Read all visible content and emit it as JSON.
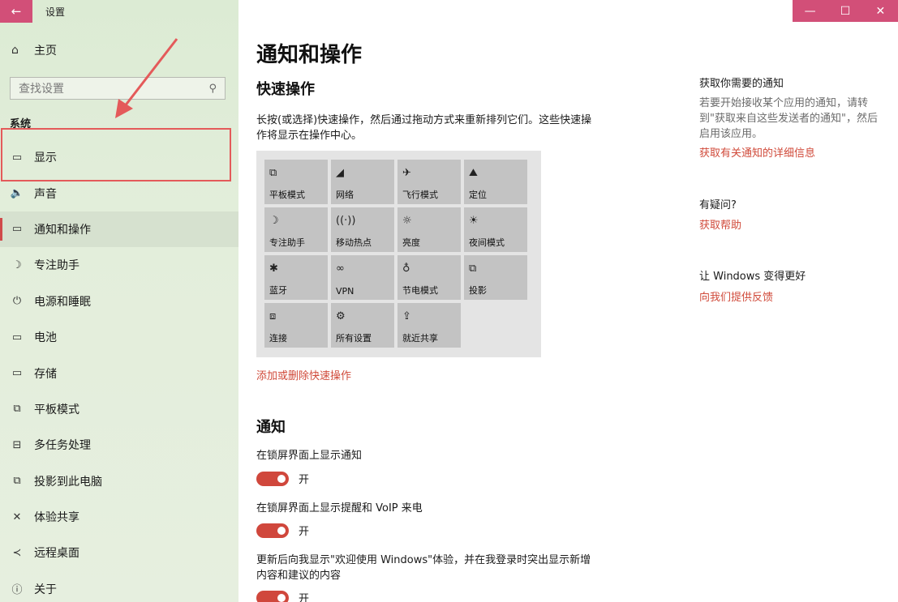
{
  "window": {
    "back_icon": "←",
    "title": "设置",
    "minimize_icon": "—",
    "maximize_icon": "☐",
    "close_icon": "✕"
  },
  "sidebar": {
    "home": {
      "icon": "⌂",
      "label": "主页"
    },
    "search": {
      "placeholder": "查找设置",
      "icon": "⚲"
    },
    "section_title": "系统",
    "items": [
      {
        "icon": "▭",
        "label": "显示"
      },
      {
        "icon": "🔈",
        "label": "声音"
      },
      {
        "icon": "▭",
        "label": "通知和操作"
      },
      {
        "icon": "☽",
        "label": "专注助手"
      },
      {
        "icon": "⏻",
        "label": "电源和睡眠"
      },
      {
        "icon": "▭",
        "label": "电池"
      },
      {
        "icon": "▭",
        "label": "存储"
      },
      {
        "icon": "⧉",
        "label": "平板模式"
      },
      {
        "icon": "⊟",
        "label": "多任务处理"
      },
      {
        "icon": "⧉",
        "label": "投影到此电脑"
      },
      {
        "icon": "✕",
        "label": "体验共享"
      },
      {
        "icon": "≺",
        "label": "远程桌面"
      },
      {
        "icon": "ⓘ",
        "label": "关于"
      }
    ],
    "active_index": 2
  },
  "main": {
    "page_title": "通知和操作",
    "quick_actions": {
      "title": "快速操作",
      "description": "长按(或选择)快速操作，然后通过拖动方式来重新排列它们。这些快速操作将显示在操作中心。",
      "tiles": [
        {
          "icon": "⧉",
          "label": "平板模式"
        },
        {
          "icon": "◢",
          "label": "网络"
        },
        {
          "icon": "✈",
          "label": "飞行模式"
        },
        {
          "icon": "⛰",
          "label": "定位"
        },
        {
          "icon": "☽",
          "label": "专注助手"
        },
        {
          "icon": "((·))",
          "label": "移动热点"
        },
        {
          "icon": "☼",
          "label": "亮度"
        },
        {
          "icon": "☀",
          "label": "夜间模式"
        },
        {
          "icon": "✱",
          "label": "蓝牙"
        },
        {
          "icon": "∞",
          "label": "VPN"
        },
        {
          "icon": "♁",
          "label": "节电模式"
        },
        {
          "icon": "⧉",
          "label": "投影"
        },
        {
          "icon": "⧈",
          "label": "连接"
        },
        {
          "icon": "⚙",
          "label": "所有设置"
        },
        {
          "icon": "⇪",
          "label": "就近共享"
        }
      ],
      "add_remove_link": "添加或删除快速操作"
    },
    "notifications": {
      "title": "通知",
      "settings": [
        {
          "label": "在锁屏界面上显示通知",
          "state": "开"
        },
        {
          "label": "在锁屏界面上显示提醒和 VoIP 来电",
          "state": "开"
        },
        {
          "label": "更新后向我显示\"欢迎使用 Windows\"体验，并在我登录时突出显示新增内容和建议的内容",
          "state": "开"
        }
      ]
    }
  },
  "right_panel": {
    "notify_title": "获取你需要的通知",
    "notify_desc": "若要开始接收某个应用的通知，请转到\"获取来自这些发送者的通知\"，然后启用该应用。",
    "notify_link": "获取有关通知的详细信息",
    "question_title": "有疑问?",
    "help_link": "获取帮助",
    "improve_title": "让 Windows 变得更好",
    "feedback_link": "向我们提供反馈"
  },
  "colors": {
    "accent": "#d04a3a",
    "titlebar": "#d24f78",
    "annotation": "#e45a5a",
    "toggle_on": "#d0473c"
  }
}
